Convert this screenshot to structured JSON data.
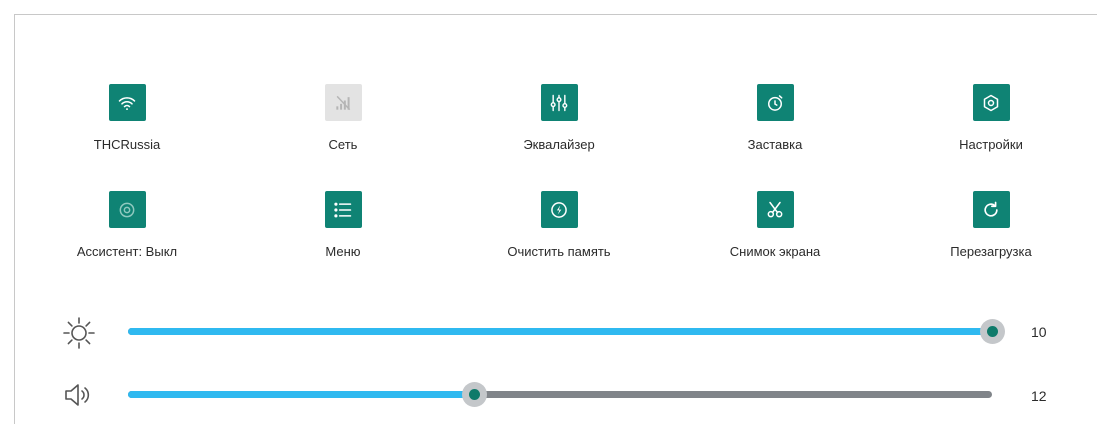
{
  "tiles": [
    {
      "label": "THCRussia",
      "icon": "wifi-icon",
      "active": true
    },
    {
      "label": "Сеть",
      "icon": "no-signal-icon",
      "active": false
    },
    {
      "label": "Эквалайзер",
      "icon": "equalizer-icon",
      "active": true
    },
    {
      "label": "Заставка",
      "icon": "screensaver-icon",
      "active": true
    },
    {
      "label": "Настройки",
      "icon": "gear-icon",
      "active": true
    },
    {
      "label": "Ассистент: Выкл",
      "icon": "assistant-icon",
      "active": true
    },
    {
      "label": "Меню",
      "icon": "menu-icon",
      "active": true
    },
    {
      "label": "Очистить память",
      "icon": "clean-memory-icon",
      "active": true
    },
    {
      "label": "Снимок экрана",
      "icon": "scissors-icon",
      "active": true
    },
    {
      "label": "Перезагрузка",
      "icon": "restart-icon",
      "active": true
    }
  ],
  "sliders": {
    "brightness": {
      "icon": "brightness-icon",
      "value": "10",
      "level_fraction": 1.0
    },
    "volume": {
      "icon": "volume-icon",
      "value": "12",
      "level_fraction": 0.4
    }
  },
  "colors": {
    "tile_active": "#0f8374",
    "tile_inactive": "#e3e3e3",
    "slider_fill": "#2fb9f0",
    "slider_track": "#808489",
    "thumb_dot": "#0f7a6a"
  }
}
